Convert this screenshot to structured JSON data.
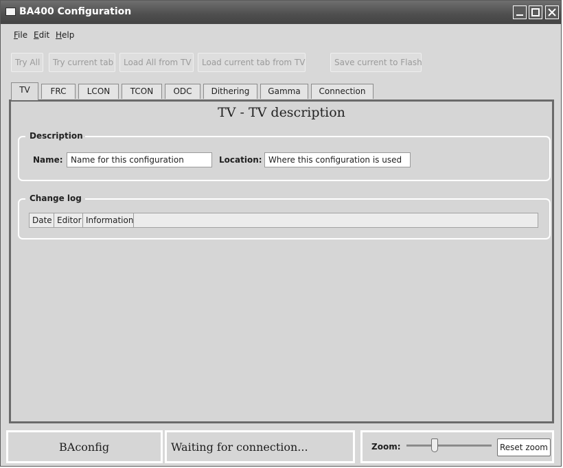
{
  "window": {
    "title": "BA400 Configuration"
  },
  "menu": {
    "file": {
      "accel": "F",
      "rest": "ile"
    },
    "edit": {
      "accel": "E",
      "rest": "dit"
    },
    "help": {
      "accel": "H",
      "rest": "elp"
    }
  },
  "toolbar": {
    "try_all": "Try All",
    "try_current_tab": "Try current tab",
    "load_all": "Load All from TV",
    "load_current_tab": "Load current tab from TV",
    "save_flash": "Save current to Flash"
  },
  "tabs": [
    "TV",
    "FRC",
    "LCON",
    "TCON",
    "ODC",
    "Dithering",
    "Gamma",
    "Connection"
  ],
  "active_tab": "TV",
  "panel": {
    "title": "TV - TV description",
    "description": {
      "title": "Description",
      "name_label": "Name:",
      "name_value": "Name for this configuration",
      "location_label": "Location:",
      "location_value": "Where this configuration is used"
    },
    "changelog": {
      "title": "Change log",
      "columns": [
        "Date",
        "Editor",
        "Information"
      ]
    }
  },
  "status": {
    "app_name": "BAconfig",
    "connection": "Waiting for connection...",
    "zoom_label": "Zoom:",
    "zoom_level": 0.32,
    "reset_zoom": "Reset zoom"
  },
  "colors": {
    "titlebar": "#4e4e4e",
    "window_bg": "#d8d8d8",
    "panel_border": "#6a6a6a",
    "disabled_text": "#9a9a9a"
  }
}
